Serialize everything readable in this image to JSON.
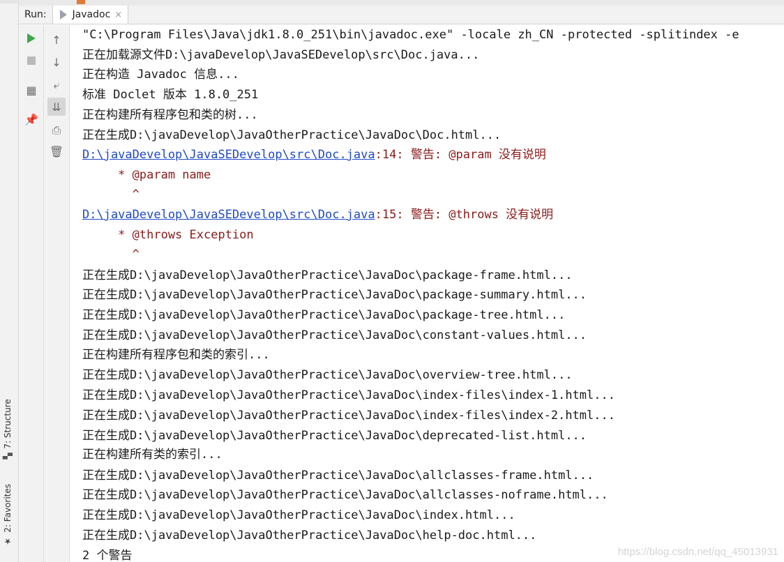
{
  "header": {
    "run_label": "Run:",
    "tab_label": "Javadoc",
    "tab_close": "×"
  },
  "side_tabs": {
    "structure": "7: Structure",
    "favorites": "2: Favorites"
  },
  "toolbar": {
    "run_icon": "play-icon",
    "stop_icon": "stop-icon",
    "layout_icon": "layout-icon",
    "pin_icon": "pin-icon",
    "up_icon": "arrow-up-icon",
    "down_icon": "arrow-down-icon",
    "wrap_icon": "soft-wrap-icon",
    "scroll_icon": "scroll-to-end-icon",
    "print_icon": "print-icon",
    "trash_icon": "trash-icon"
  },
  "colors": {
    "link": "#1f49c7",
    "warning": "#8b1a1a",
    "run_green": "#3ea84a"
  },
  "console": {
    "line1": "\"C:\\Program Files\\Java\\jdk1.8.0_251\\bin\\javadoc.exe\" -locale zh_CN -protected -splitindex -e",
    "line2": "正在加载源文件D:\\javaDevelop\\JavaSEDevelop\\src\\Doc.java...",
    "line3": "正在构造 Javadoc 信息...",
    "line4": "标准 Doclet 版本 1.8.0_251",
    "line5": "正在构建所有程序包和类的树...",
    "line6": "正在生成D:\\javaDevelop\\JavaOtherPractice\\JavaDoc\\Doc.html...",
    "warn1_link": "D:\\javaDevelop\\JavaSEDevelop\\src\\Doc.java",
    "warn1_text": ":14: 警告: @param 没有说明",
    "warn1_detail": "     * @param name",
    "warn1_caret": "       ^",
    "warn2_link": "D:\\javaDevelop\\JavaSEDevelop\\src\\Doc.java",
    "warn2_text": ":15: 警告: @throws 没有说明",
    "warn2_detail": "     * @throws Exception",
    "warn2_caret": "       ^",
    "line7": "正在生成D:\\javaDevelop\\JavaOtherPractice\\JavaDoc\\package-frame.html...",
    "line8": "正在生成D:\\javaDevelop\\JavaOtherPractice\\JavaDoc\\package-summary.html...",
    "line9": "正在生成D:\\javaDevelop\\JavaOtherPractice\\JavaDoc\\package-tree.html...",
    "line10": "正在生成D:\\javaDevelop\\JavaOtherPractice\\JavaDoc\\constant-values.html...",
    "line11": "正在构建所有程序包和类的索引...",
    "line12": "正在生成D:\\javaDevelop\\JavaOtherPractice\\JavaDoc\\overview-tree.html...",
    "line13": "正在生成D:\\javaDevelop\\JavaOtherPractice\\JavaDoc\\index-files\\index-1.html...",
    "line14": "正在生成D:\\javaDevelop\\JavaOtherPractice\\JavaDoc\\index-files\\index-2.html...",
    "line15": "正在生成D:\\javaDevelop\\JavaOtherPractice\\JavaDoc\\deprecated-list.html...",
    "line16": "正在构建所有类的索引...",
    "line17": "正在生成D:\\javaDevelop\\JavaOtherPractice\\JavaDoc\\allclasses-frame.html...",
    "line18": "正在生成D:\\javaDevelop\\JavaOtherPractice\\JavaDoc\\allclasses-noframe.html...",
    "line19": "正在生成D:\\javaDevelop\\JavaOtherPractice\\JavaDoc\\index.html...",
    "line20": "正在生成D:\\javaDevelop\\JavaOtherPractice\\JavaDoc\\help-doc.html...",
    "line21": "2 个警告"
  },
  "watermark": "https://blog.csdn.net/qq_45013931"
}
